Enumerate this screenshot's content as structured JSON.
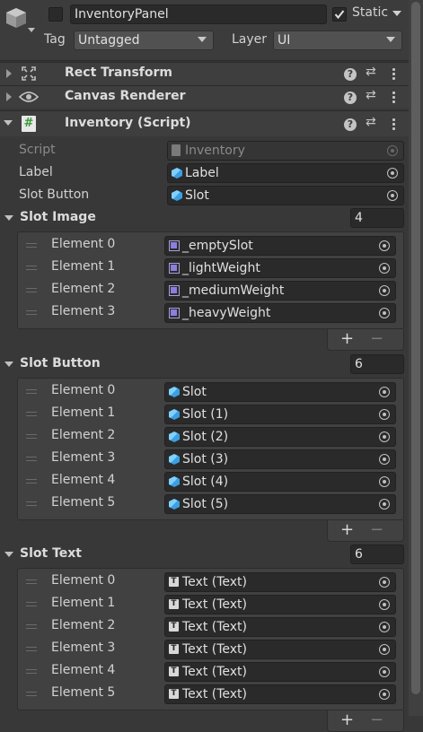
{
  "header": {
    "object_name": "InventoryPanel",
    "static_label": "Static",
    "tag_label": "Tag",
    "tag_value": "Untagged",
    "layer_label": "Layer",
    "layer_value": "UI"
  },
  "components": [
    {
      "title": "Rect Transform",
      "icon": "rect-transform-icon"
    },
    {
      "title": "Canvas Renderer",
      "icon": "eye-icon"
    },
    {
      "title": "Inventory (Script)",
      "icon": "script-hash-icon"
    }
  ],
  "inventory": {
    "script_label": "Script",
    "script_value": "Inventory",
    "label_label": "Label",
    "label_value": "Label",
    "slot_button_label": "Slot Button",
    "slot_button_value": "Slot"
  },
  "lists": [
    {
      "title": "Slot Image",
      "size": "4",
      "icon": "sprite-icon",
      "elements": [
        {
          "label": "Element 0",
          "value": "_emptySlot"
        },
        {
          "label": "Element 1",
          "value": "_lightWeight"
        },
        {
          "label": "Element 2",
          "value": "_mediumWeight"
        },
        {
          "label": "Element 3",
          "value": "_heavyWeight"
        }
      ]
    },
    {
      "title": "Slot Button",
      "size": "6",
      "icon": "prefab-cube-icon",
      "elements": [
        {
          "label": "Element 0",
          "value": "Slot"
        },
        {
          "label": "Element 1",
          "value": "Slot (1)"
        },
        {
          "label": "Element 2",
          "value": "Slot (2)"
        },
        {
          "label": "Element 3",
          "value": "Slot (3)"
        },
        {
          "label": "Element 4",
          "value": "Slot (4)"
        },
        {
          "label": "Element 5",
          "value": "Slot (5)"
        }
      ]
    },
    {
      "title": "Slot Text",
      "size": "6",
      "icon": "text-component-icon",
      "elements": [
        {
          "label": "Element 0",
          "value": "Text (Text)"
        },
        {
          "label": "Element 1",
          "value": "Text (Text)"
        },
        {
          "label": "Element 2",
          "value": "Text (Text)"
        },
        {
          "label": "Element 3",
          "value": "Text (Text)"
        },
        {
          "label": "Element 4",
          "value": "Text (Text)"
        },
        {
          "label": "Element 5",
          "value": "Text (Text)"
        }
      ]
    }
  ],
  "list_controls": {
    "add": "+",
    "remove": "−"
  },
  "colors": {
    "background": "#383838",
    "field": "#2a2a2a",
    "prefab_blue": "#3c9fe0"
  }
}
